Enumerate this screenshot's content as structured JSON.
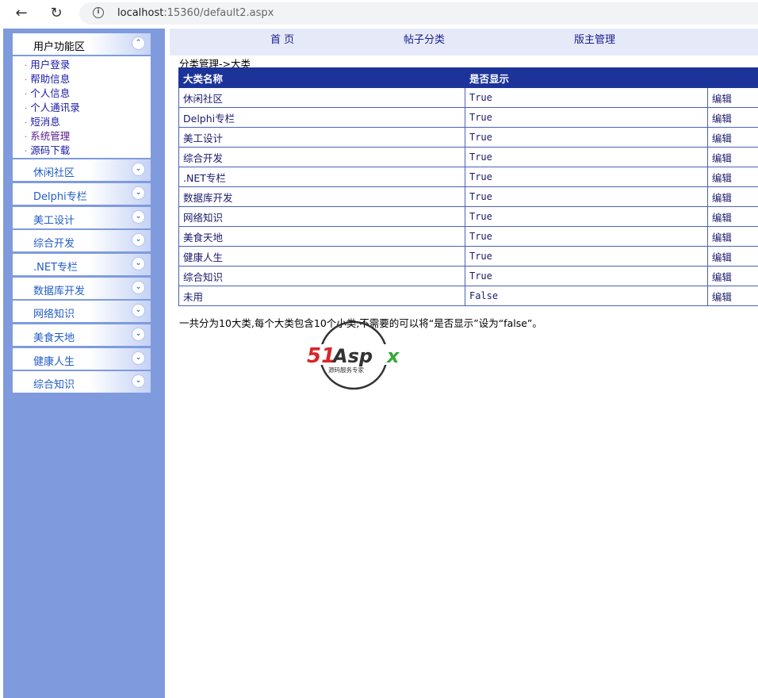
{
  "browser": {
    "url_host": "localhost",
    "url_rest": ":15360/default2.aspx"
  },
  "sidebar": {
    "open_panel": {
      "title": "用户功能区",
      "items": [
        "用户登录",
        "帮助信息",
        "个人信息",
        "个人通讯录",
        "短消息",
        "系统管理",
        "源码下载"
      ]
    },
    "panels": [
      "休闲社区",
      "Delphi专栏",
      "美工设计",
      "综合开发",
      ".NET专栏",
      "数据库开发",
      "网络知识",
      "美食天地",
      "健康人生",
      "综合知识"
    ]
  },
  "topmenu": [
    "首 页",
    "帖子分类",
    "版主管理"
  ],
  "breadcrumb": "分类管理->大类",
  "table": {
    "headers": [
      "大类名称",
      "是否显示",
      ""
    ],
    "rows": [
      {
        "name": "休闲社区",
        "show": "True",
        "action": "编辑"
      },
      {
        "name": "Delphi专栏",
        "show": "True",
        "action": "编辑"
      },
      {
        "name": "美工设计",
        "show": "True",
        "action": "编辑"
      },
      {
        "name": "综合开发",
        "show": "True",
        "action": "编辑"
      },
      {
        "name": ".NET专栏",
        "show": "True",
        "action": "编辑"
      },
      {
        "name": "数据库开发",
        "show": "True",
        "action": "编辑"
      },
      {
        "name": "网络知识",
        "show": "True",
        "action": "编辑"
      },
      {
        "name": "美食天地",
        "show": "True",
        "action": "编辑"
      },
      {
        "name": "健康人生",
        "show": "True",
        "action": "编辑"
      },
      {
        "name": "综合知识",
        "show": "True",
        "action": "编辑"
      },
      {
        "name": "未用",
        "show": "False",
        "action": "编辑"
      }
    ]
  },
  "note": "一共分为10大类,每个大类包含10个小类,不需要的可以将“是否显示”设为“false”。",
  "watermark": {
    "brand": "51Aspx",
    "tagline": "源码服务专家",
    "colors": {
      "red": "#d9252b",
      "green": "#3aa63a",
      "dark": "#333333"
    }
  }
}
